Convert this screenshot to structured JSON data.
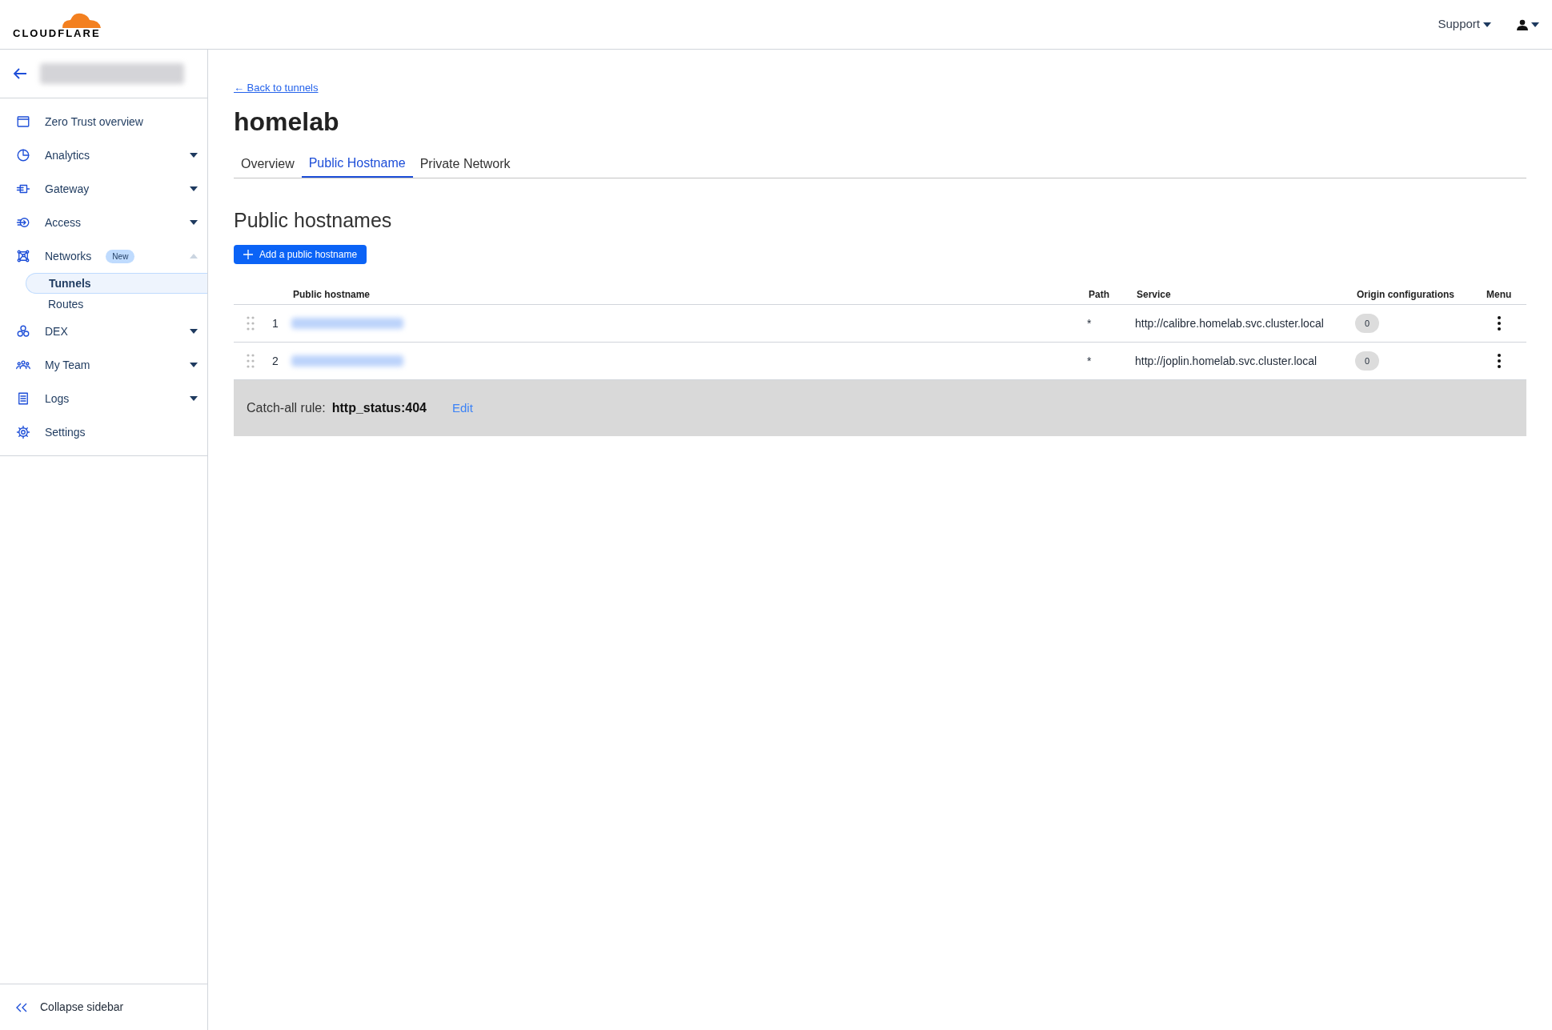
{
  "header": {
    "logo": "CLOUDFLARE",
    "support": "Support"
  },
  "sidebar": {
    "items": [
      {
        "label": "Zero Trust overview"
      },
      {
        "label": "Analytics",
        "expanded": false
      },
      {
        "label": "Gateway",
        "expanded": false
      },
      {
        "label": "Access",
        "expanded": false
      },
      {
        "label": "Networks",
        "badge": "New",
        "expanded": true,
        "children": [
          {
            "label": "Tunnels",
            "selected": true
          },
          {
            "label": "Routes",
            "selected": false
          }
        ]
      },
      {
        "label": "DEX",
        "expanded": false
      },
      {
        "label": "My Team",
        "expanded": false
      },
      {
        "label": "Logs",
        "expanded": false
      },
      {
        "label": "Settings"
      }
    ],
    "collapse": "Collapse sidebar"
  },
  "back_link": "← Back to tunnels",
  "title": "homelab",
  "tabs": [
    {
      "label": "Overview",
      "selected": false
    },
    {
      "label": "Public Hostname",
      "selected": true
    },
    {
      "label": "Private Network",
      "selected": false
    }
  ],
  "section_title": "Public hostnames",
  "add_button": "Add a public hostname",
  "table": {
    "columns": [
      "Public hostname",
      "Path",
      "Service",
      "Origin configurations",
      "Menu"
    ],
    "rows": [
      {
        "index": "1",
        "path": "*",
        "service": "http://calibre.homelab.svc.cluster.local",
        "origin_configurations": "0"
      },
      {
        "index": "2",
        "path": "*",
        "service": "http://joplin.homelab.svc.cluster.local",
        "origin_configurations": "0"
      }
    ]
  },
  "catch_all": {
    "label": "Catch-all rule:",
    "value": "http_status:404",
    "edit": "Edit"
  }
}
